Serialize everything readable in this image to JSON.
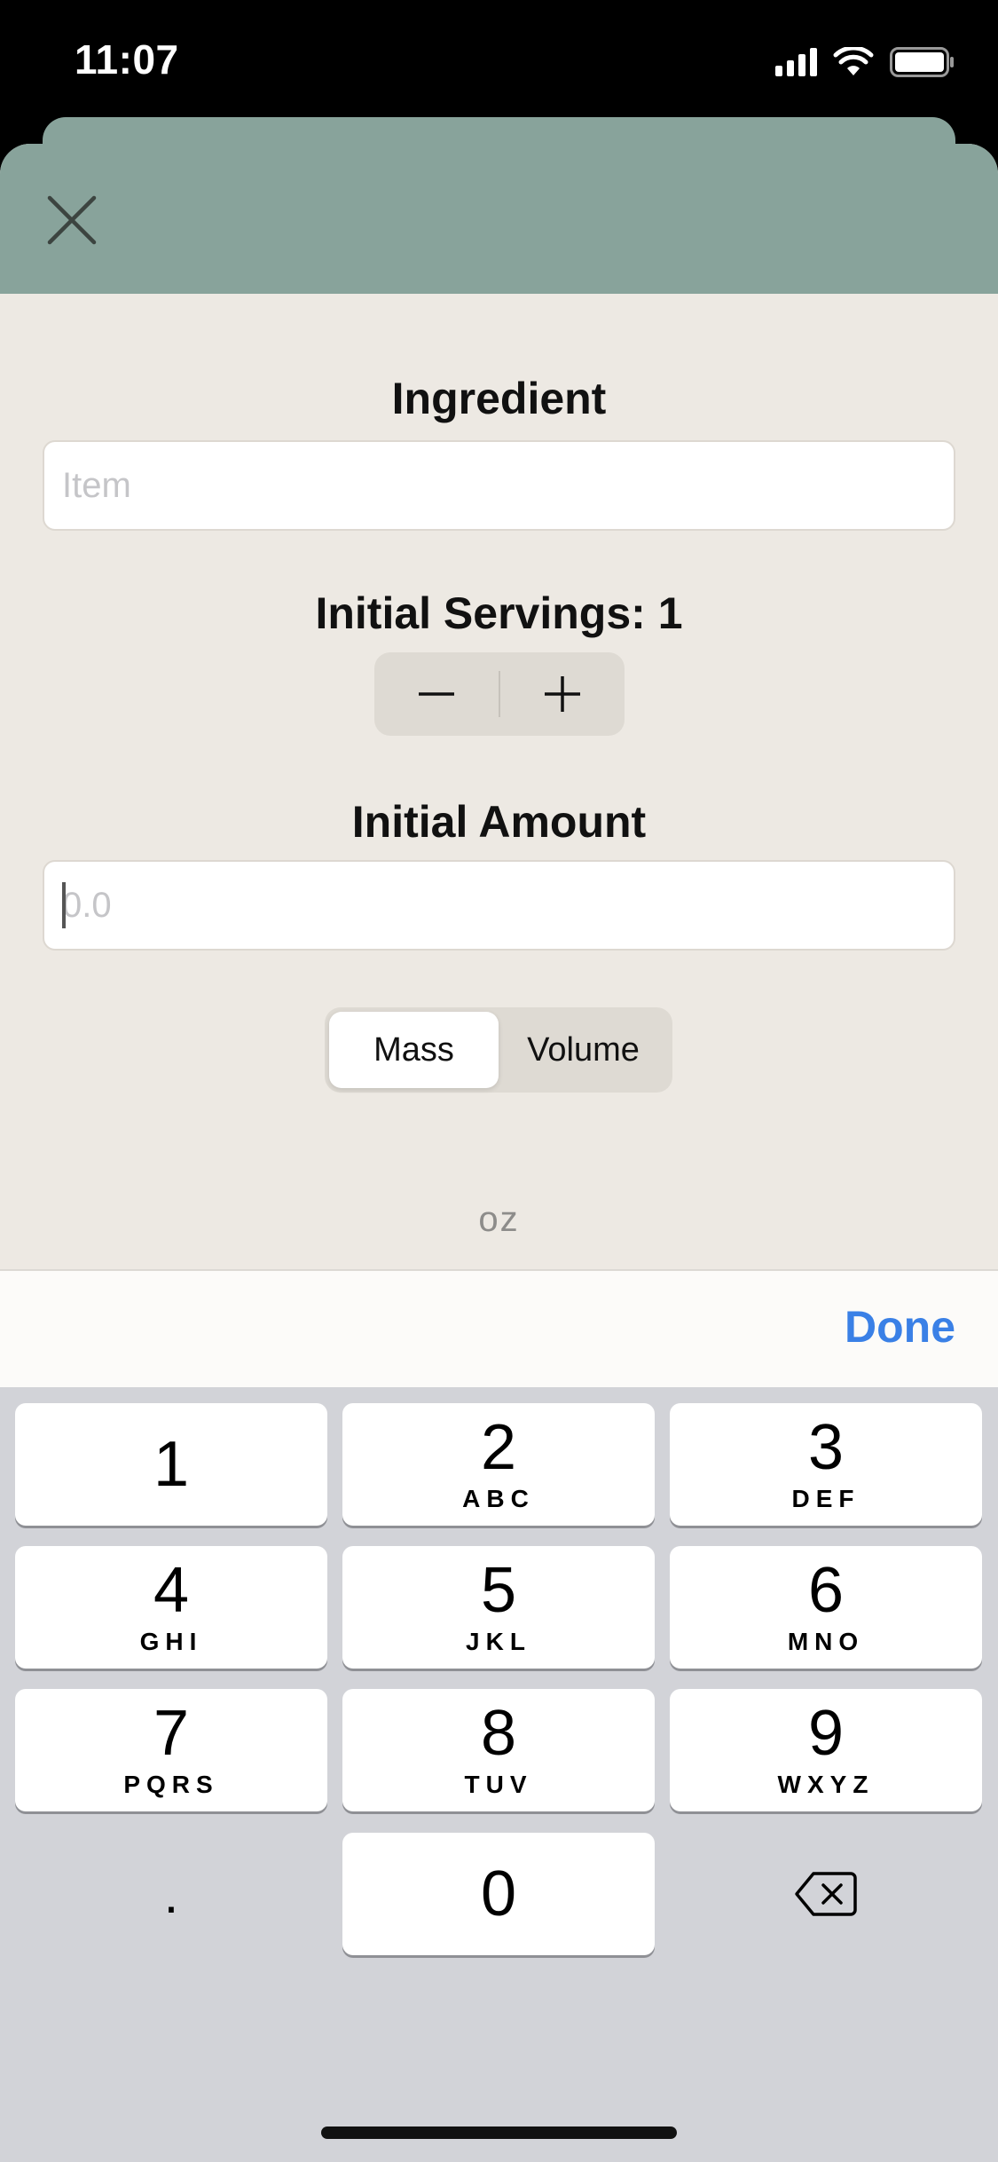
{
  "status_bar": {
    "time": "11:07"
  },
  "ingredient": {
    "title": "Ingredient",
    "placeholder": "Item",
    "value": ""
  },
  "servings": {
    "label": "Initial Servings:",
    "value": "1"
  },
  "amount": {
    "title": "Initial Amount",
    "placeholder": "0.0",
    "value": ""
  },
  "measure_type": {
    "options": [
      "Mass",
      "Volume"
    ],
    "selected": "Mass"
  },
  "unit": "oz",
  "accessory": {
    "done_label": "Done"
  },
  "keyboard": {
    "keys": [
      {
        "num": "1",
        "letters": ""
      },
      {
        "num": "2",
        "letters": "ABC"
      },
      {
        "num": "3",
        "letters": "DEF"
      },
      {
        "num": "4",
        "letters": "GHI"
      },
      {
        "num": "5",
        "letters": "JKL"
      },
      {
        "num": "6",
        "letters": "MNO"
      },
      {
        "num": "7",
        "letters": "PQRS"
      },
      {
        "num": "8",
        "letters": "TUV"
      },
      {
        "num": "9",
        "letters": "WXYZ"
      },
      {
        "num": "0",
        "letters": ""
      }
    ],
    "decimal": "."
  },
  "colors": {
    "header": "#88a39b",
    "background": "#ede9e3",
    "accent": "#3a80e6",
    "keyboard": "#d2d3d8"
  },
  "icons": {
    "close": "close-icon",
    "minus": "minus-icon",
    "plus": "plus-icon",
    "delete": "delete-icon"
  }
}
